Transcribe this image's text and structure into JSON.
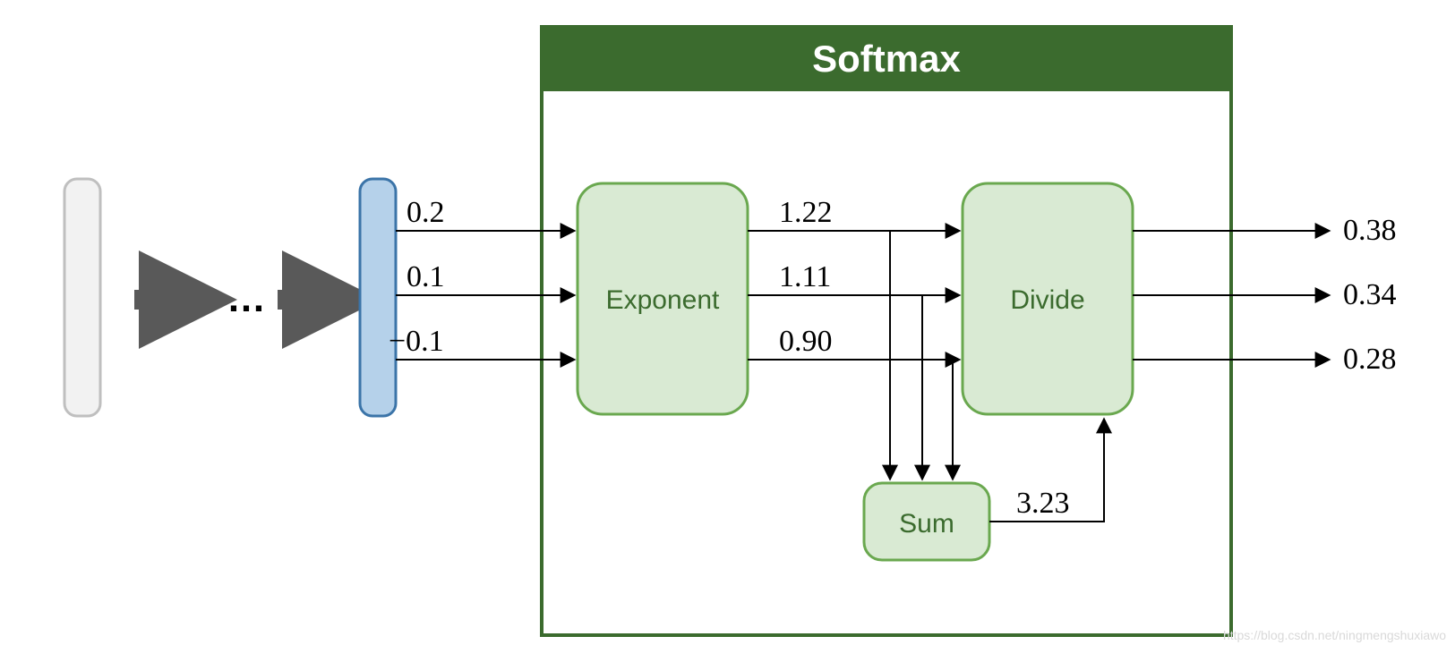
{
  "title": "Softmax",
  "inputs": [
    "0.2",
    "0.1",
    "−0.1"
  ],
  "exponents": [
    "1.22",
    "1.11",
    "0.90"
  ],
  "sum": "3.23",
  "outputs": [
    "0.38",
    "0.34",
    "0.28"
  ],
  "blocks": {
    "exponent": "Exponent",
    "sum": "Sum",
    "divide": "Divide"
  },
  "ellipsis": "…",
  "watermark": "https://blog.csdn.net/ningmengshuxiawo"
}
